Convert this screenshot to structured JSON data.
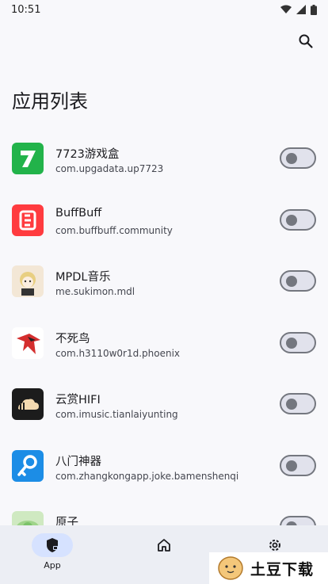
{
  "status": {
    "time": "10:51"
  },
  "page": {
    "title": "应用列表"
  },
  "apps": [
    {
      "name": "7723游戏盒",
      "package": "com.upgadata.up7723",
      "enabled": false,
      "icon": "7723-icon",
      "icon_color": "#22b34a"
    },
    {
      "name": "BuffBuff",
      "package": "com.buffbuff.community",
      "enabled": false,
      "icon": "buffbuff-icon",
      "icon_color": "#ff3b3f"
    },
    {
      "name": "MPDL音乐",
      "package": "me.sukimon.mdl",
      "enabled": false,
      "icon": "mpdl-icon",
      "icon_color": "#f3e7d6"
    },
    {
      "name": "不死鸟",
      "package": "com.h3110w0r1d.phoenix",
      "enabled": false,
      "icon": "phoenix-icon",
      "icon_color": "#d42e2e"
    },
    {
      "name": "云赏HIFI",
      "package": "com.imusic.tianlaiyunting",
      "enabled": false,
      "icon": "yunshang-icon",
      "icon_color": "#1c1c1c"
    },
    {
      "name": "八门神器",
      "package": "com.zhangkongapp.joke.bamenshenqi",
      "enabled": false,
      "icon": "bamen-icon",
      "icon_color": "#1c8de6"
    },
    {
      "name": "原子",
      "package": "",
      "enabled": false,
      "icon": "yuanzi-icon",
      "icon_color": "#9fd48a"
    }
  ],
  "nav": {
    "app_label": "App"
  },
  "watermark": {
    "text": "土豆下载"
  },
  "colors": {
    "accent_pill": "#d6e2ff",
    "switch_off": "#74777f"
  }
}
